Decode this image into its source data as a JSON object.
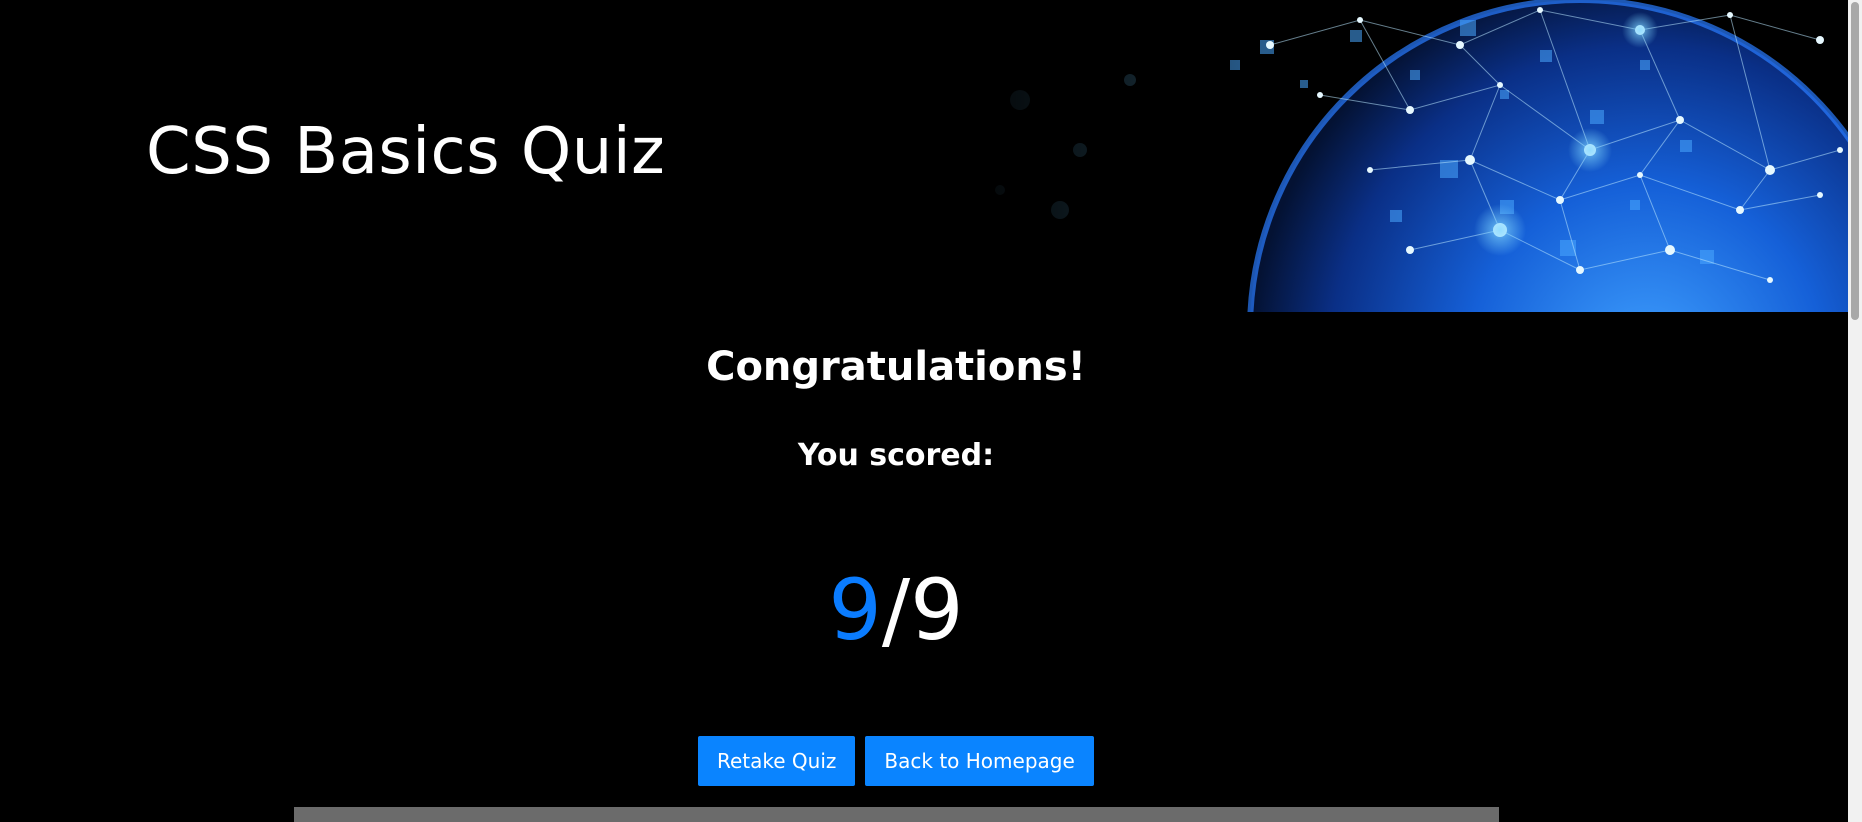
{
  "banner": {
    "title": "CSS Basics Quiz"
  },
  "result": {
    "heading": "Congratulations!",
    "subheading": "You scored:",
    "score": {
      "correct": "9",
      "separator": "/",
      "total": "9"
    }
  },
  "actions": {
    "retake_label": "Retake Quiz",
    "home_label": "Back to Homepage"
  },
  "colors": {
    "background": "#000000",
    "accent": "#0a84ff",
    "score_highlight": "#0a7cff",
    "text": "#ffffff",
    "footer_bar": "#6b6b6b"
  },
  "icons": {
    "banner_art": "network-globe-graphic"
  }
}
